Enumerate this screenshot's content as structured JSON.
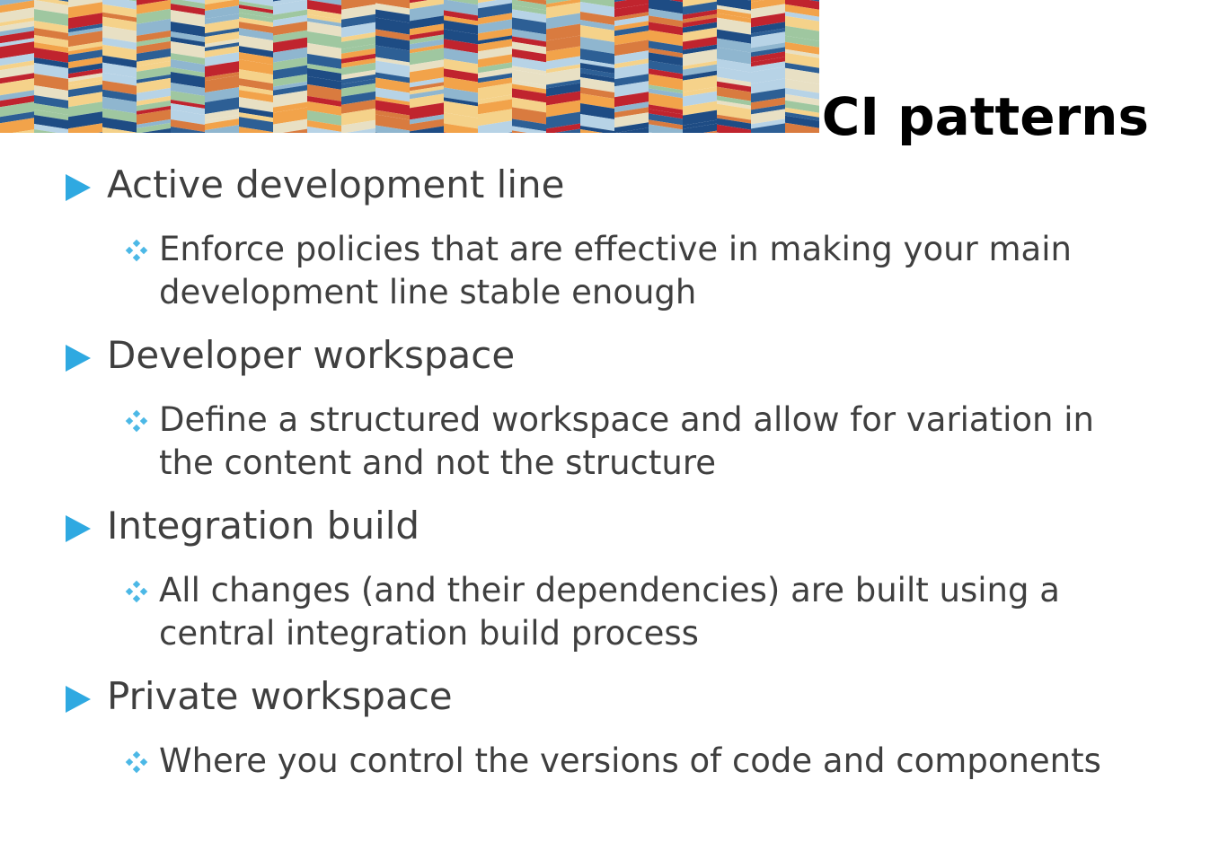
{
  "slide": {
    "title": "CI patterns",
    "colors": {
      "bullet_primary": "#2fa9e1",
      "bullet_secondary": "#4cb8e6",
      "text": "#3f3f3f",
      "title": "#000000"
    },
    "banner_palette": [
      "#2d5f95",
      "#c0242e",
      "#f2a34a",
      "#9fc7a0",
      "#f5d28a",
      "#8fb6cf",
      "#e8e0c4",
      "#1e4c84",
      "#d97b3f",
      "#b7d3e6"
    ],
    "items": [
      {
        "heading": "Active development line",
        "detail": "Enforce policies that are effective in making your main development line stable enough"
      },
      {
        "heading": "Developer workspace",
        "detail": "Define a structured workspace and allow for variation in the content and not the structure"
      },
      {
        "heading": "Integration build",
        "detail": "All changes (and their dependencies) are built using a central integration build process"
      },
      {
        "heading": "Private workspace",
        "detail": "Where you control the versions of code and components"
      }
    ]
  }
}
